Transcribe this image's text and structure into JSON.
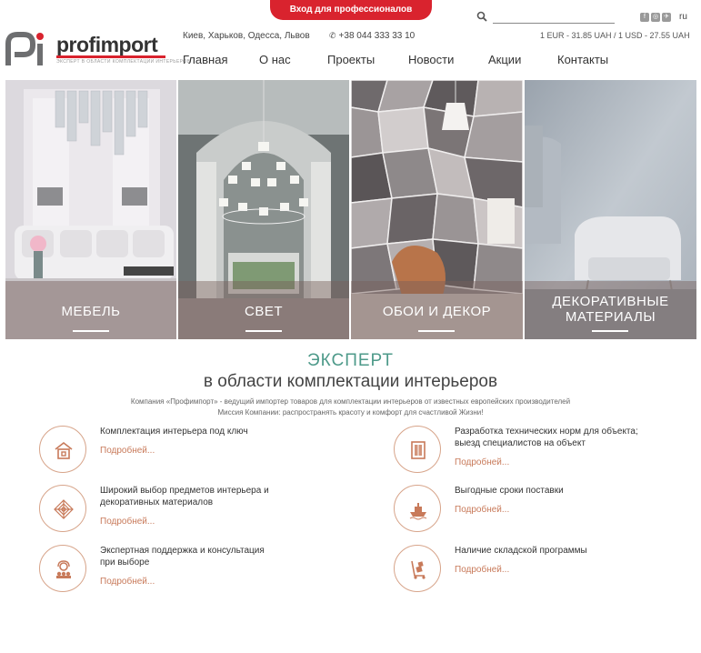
{
  "header": {
    "pro_button": "Вход для профессионалов",
    "logo_word": "profimport",
    "logo_tagline": "ЭКСПЕРТ В ОБЛАСТИ КОМПЛЕКТАЦИИ ИНТЕРЬЕРОВ",
    "cities": "Киев, Харьков, Одесса, Львов",
    "phone": "+38 044 333 33 10",
    "search_placeholder": "",
    "language": "ru",
    "rates": "1 EUR - 31.85 UAH / 1 USD - 27.55 UAH",
    "socials": [
      "f",
      "◎",
      "✈"
    ],
    "nav": [
      "Главная",
      "О нас",
      "Проекты",
      "Новости",
      "Акции",
      "Контакты"
    ]
  },
  "tiles": [
    {
      "label": "МЕБЕЛЬ"
    },
    {
      "label": "СВЕТ"
    },
    {
      "label": "ОБОИ И ДЕКОР"
    },
    {
      "label_line1": "ДЕКОРАТИВНЫЕ",
      "label_line2": "МАТЕРИАЛЫ"
    }
  ],
  "expert": {
    "title": "ЭКСПЕРТ",
    "subtitle": "в области комплектации интерьеров",
    "desc_line1": "Компания «Профимпорт» - ведущий импортер товаров для комплектации интерьеров от известных европейских производителей",
    "desc_line2": "Миссия Компании: распространять красоту и комфорт для счастливой Жизни!"
  },
  "features": [
    {
      "title": "Комплектация интерьера под ключ",
      "more": "Подробней...",
      "icon": "house-icon"
    },
    {
      "title_line1": "Разработка технических норм для объекта;",
      "title_line2": "выезд специалистов на объект",
      "more": "Подробней...",
      "icon": "door-icon"
    },
    {
      "title_line1": "Широкий выбор предметов интерьера и",
      "title_line2": "декоративных материалов",
      "more": "Подробней...",
      "icon": "pattern-icon"
    },
    {
      "title": "Выгодные сроки поставки",
      "more": "Подробней...",
      "icon": "ship-icon"
    },
    {
      "title_line1": "Экспертная поддержка и консультация",
      "title_line2": "при выборе",
      "more": "Подробней...",
      "icon": "support-icon"
    },
    {
      "title": "Наличие складской программы",
      "more": "Подробней...",
      "icon": "cart-icon"
    }
  ],
  "colors": {
    "accent_red": "#d9232e",
    "accent_teal": "#4e9a8a",
    "accent_copper": "#c87a5a"
  }
}
